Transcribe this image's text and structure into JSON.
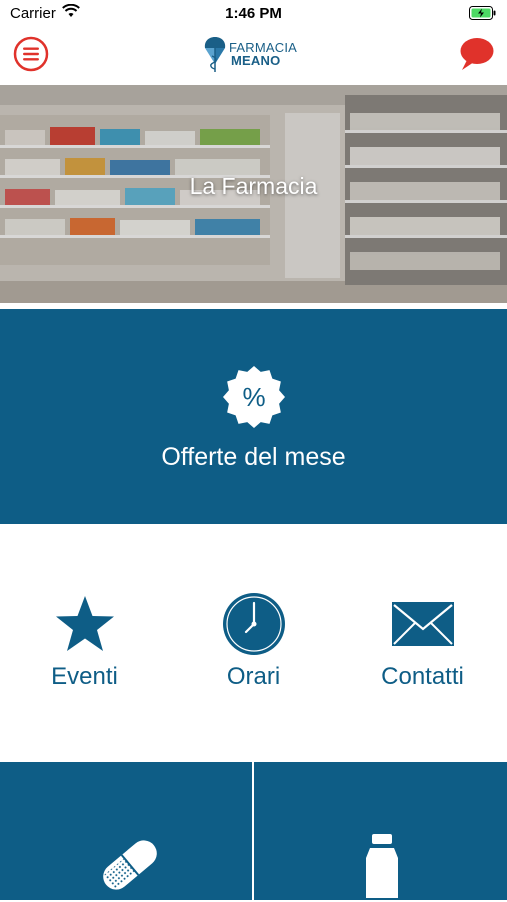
{
  "status_bar": {
    "carrier": "Carrier",
    "time": "1:46 PM",
    "icons": [
      "wifi-icon",
      "battery-charging-icon"
    ]
  },
  "nav": {
    "menu_icon": "hamburger-menu-icon",
    "logo_line1": "FARMACIA",
    "logo_line2": "MEANO",
    "chat_icon": "chat-bubble-icon"
  },
  "hero": {
    "title": "La Farmacia"
  },
  "offers": {
    "label": "Offerte del mese",
    "icon": "percent-badge-icon"
  },
  "quick_links": [
    {
      "label": "Eventi",
      "icon": "star-icon"
    },
    {
      "label": "Orari",
      "icon": "clock-icon"
    },
    {
      "label": "Contatti",
      "icon": "envelope-icon"
    }
  ],
  "tiles": [
    {
      "icon": "pill-icon"
    },
    {
      "icon": "bottle-icon"
    }
  ],
  "colors": {
    "primary": "#0e5d86",
    "accent_red": "#e0322b",
    "white": "#ffffff"
  }
}
